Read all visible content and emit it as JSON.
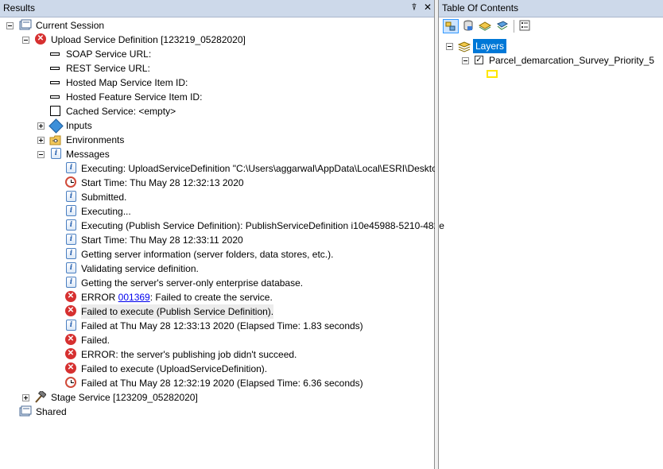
{
  "results": {
    "title": "Results",
    "pin_glyph": "⍒",
    "close_glyph": "✕",
    "items": {
      "current_session": "Current Session",
      "upload_service": "Upload Service Definition [123219_05282020]",
      "soap_url": "SOAP Service URL:",
      "rest_url": "REST Service URL:",
      "hosted_map": "Hosted Map Service Item ID:",
      "hosted_feature": "Hosted Feature Service Item ID:",
      "cached_service": "Cached Service: <empty>",
      "inputs": "Inputs",
      "environments": "Environments",
      "messages": "Messages",
      "stage_service": "Stage Service [123209_05282020]",
      "shared": "Shared"
    },
    "messages": [
      {
        "icon": "info-icon",
        "text": "Executing: UploadServiceDefinition \"C:\\Users\\aggarwal\\AppData\\Local\\ESRI\\Deskto"
      },
      {
        "icon": "clock-icon",
        "text": "Start Time: Thu May 28 12:32:13 2020"
      },
      {
        "icon": "info-icon",
        "text": "Submitted."
      },
      {
        "icon": "info-icon",
        "text": "Executing..."
      },
      {
        "icon": "info-icon",
        "text": "Executing (Publish Service Definition): PublishServiceDefinition i10e45988-5210-482e"
      },
      {
        "icon": "info-icon",
        "text": "Start Time: Thu May 28 12:33:11 2020"
      },
      {
        "icon": "info-icon",
        "text": "Getting server information (server folders, data stores, etc.)."
      },
      {
        "icon": "info-icon",
        "text": "Validating service definition."
      },
      {
        "icon": "info-icon",
        "text": "Getting the server's server-only enterprise database."
      },
      {
        "icon": "error-icon",
        "prefix": "ERROR ",
        "link": "001369",
        "text": ": Failed to create the service."
      },
      {
        "icon": "error-icon",
        "text": "Failed to execute (Publish Service Definition).",
        "highlight": true
      },
      {
        "icon": "info-icon",
        "text": "Failed at Thu May 28 12:33:13 2020 (Elapsed Time: 1.83 seconds)"
      },
      {
        "icon": "error-icon",
        "text": "Failed."
      },
      {
        "icon": "error-icon",
        "text": "ERROR: the server's publishing job didn't succeed."
      },
      {
        "icon": "error-icon",
        "text": "Failed to execute (UploadServiceDefinition)."
      },
      {
        "icon": "clock-icon",
        "text": "Failed at Thu May 28 12:32:19 2020 (Elapsed Time: 6.36 seconds)"
      }
    ]
  },
  "toc": {
    "title": "Table Of Contents",
    "layers_label": "Layers",
    "layer_name": "Parcel_demarcation_Survey_Priority_5",
    "checkmark": "✓",
    "symbol_color": "#ffe600"
  },
  "colors": {
    "titlebar": "#cdd9ea",
    "selection": "#0078d7",
    "error": "#d63030",
    "link": "#0000ee"
  }
}
